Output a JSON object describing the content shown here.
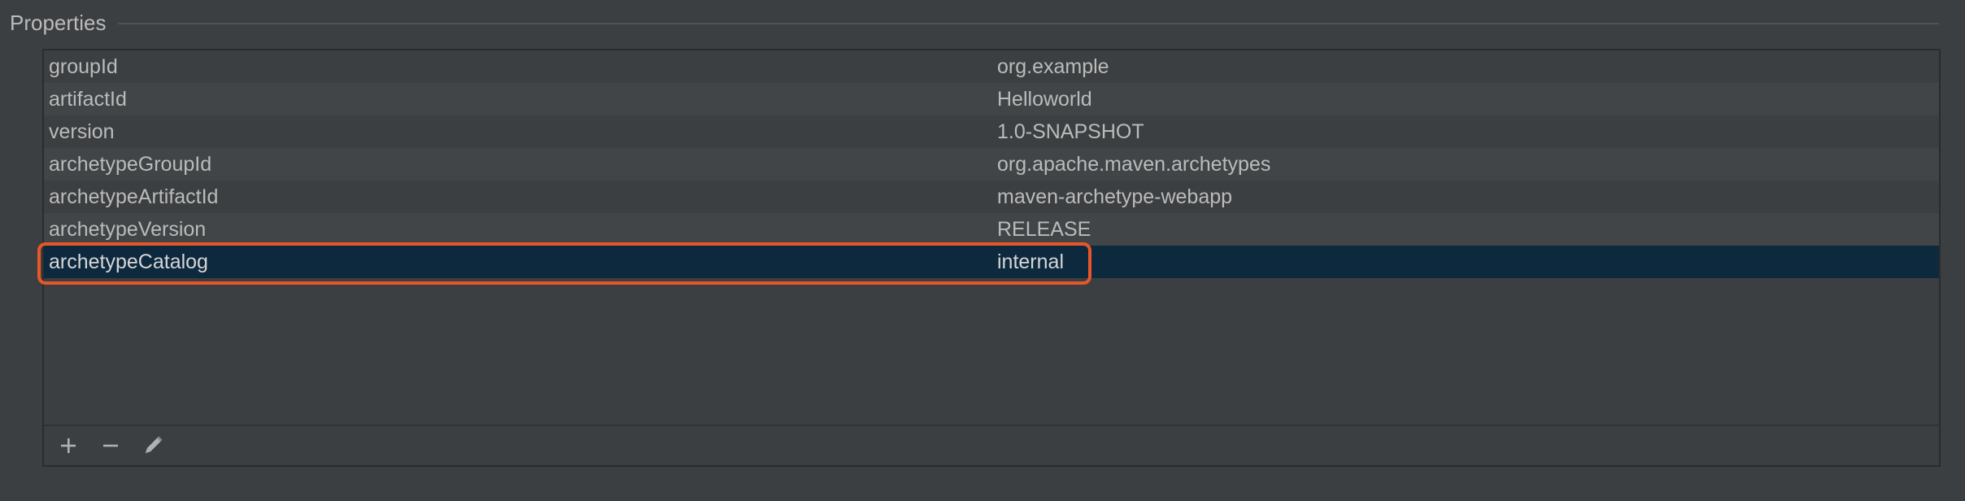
{
  "section": {
    "title": "Properties"
  },
  "properties": [
    {
      "key": "groupId",
      "value": "org.example"
    },
    {
      "key": "artifactId",
      "value": "Helloworld"
    },
    {
      "key": "version",
      "value": "1.0-SNAPSHOT"
    },
    {
      "key": "archetypeGroupId",
      "value": "org.apache.maven.archetypes"
    },
    {
      "key": "archetypeArtifactId",
      "value": "maven-archetype-webapp"
    },
    {
      "key": "archetypeVersion",
      "value": "RELEASE"
    },
    {
      "key": "archetypeCatalog",
      "value": "internal"
    }
  ],
  "toolbar": {
    "add_icon": "plus-icon",
    "remove_icon": "minus-icon",
    "edit_icon": "pencil-icon"
  },
  "colors": {
    "background": "#3c3f41",
    "row_alt": "#414547",
    "selection": "#0d293e",
    "highlight_border": "#e8562a",
    "text": "#bbbbbb"
  }
}
